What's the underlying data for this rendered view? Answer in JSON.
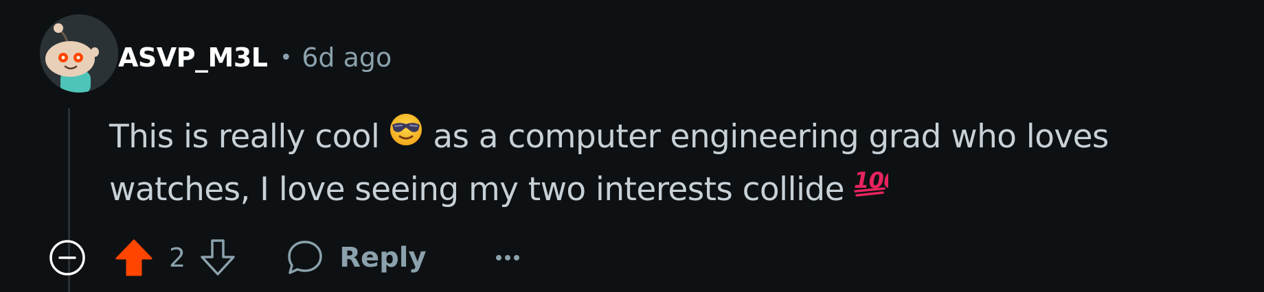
{
  "comment": {
    "author": "ASVP_M3L",
    "separator": "•",
    "timestamp": "6d ago",
    "body": {
      "part1": "This is really cool",
      "emoji1": "smiling-face-with-sunglasses",
      "part2": "as a computer engineering grad who loves watches, I love seeing my two interests collide",
      "emoji2": "hundred-points"
    }
  },
  "actions": {
    "vote_count": "2",
    "reply_label": "Reply"
  },
  "colors": {
    "background": "#0e1113",
    "upvote_active": "#ff4500",
    "meta_text": "#8ba2ad",
    "body_text": "#c7d1d7"
  }
}
